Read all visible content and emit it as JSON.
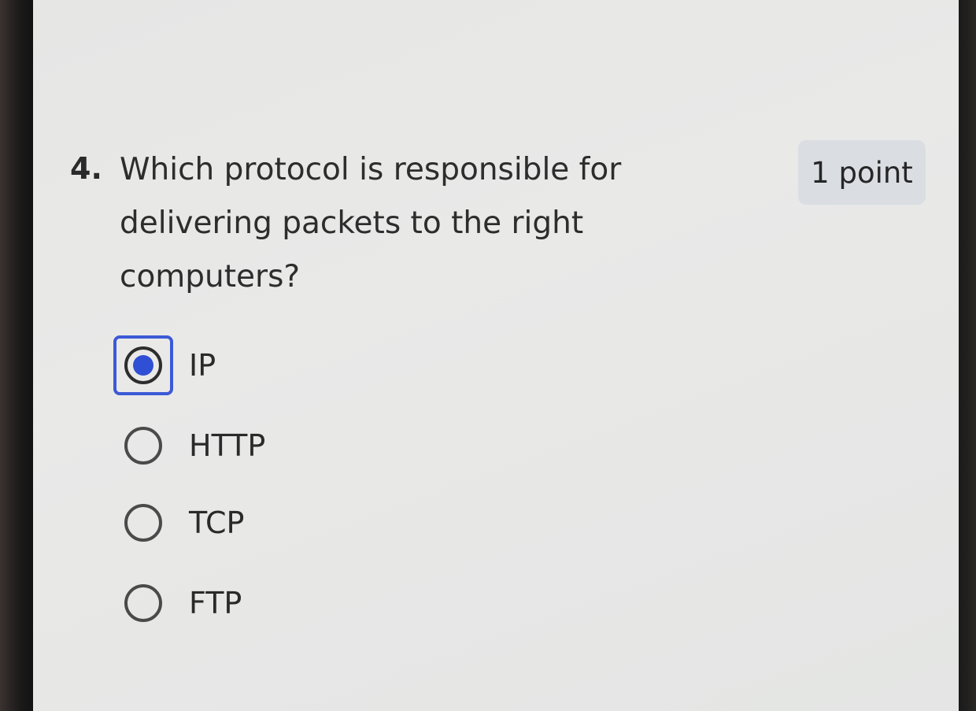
{
  "question": {
    "number": "4.",
    "text": "Which protocol is responsible for delivering packets to the right computers?",
    "points": "1 point"
  },
  "options": [
    {
      "label": "IP",
      "selected": true
    },
    {
      "label": "HTTP",
      "selected": false
    },
    {
      "label": "TCP",
      "selected": false
    },
    {
      "label": "FTP",
      "selected": false
    }
  ],
  "colors": {
    "accent": "#2f4fd4",
    "badge_background": "#dadee3",
    "screen_background": "#e7e7e6"
  }
}
